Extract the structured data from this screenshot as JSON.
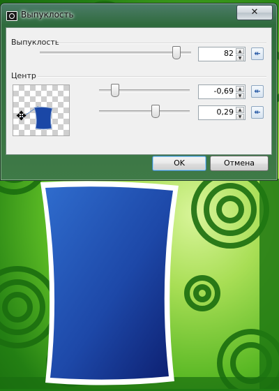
{
  "window": {
    "title": "Выпуклость",
    "close_glyph": "✕"
  },
  "convexity": {
    "label": "Выпуклость",
    "value": "82",
    "slider_fraction": 0.82
  },
  "center": {
    "label": "Центр",
    "x_value": "-0,69",
    "y_value": "0,29"
  },
  "buttons": {
    "ok_label": "OK",
    "cancel_label": "Отмена"
  },
  "icons": {
    "reset": "↞",
    "spin_up": "▲",
    "spin_down": "▼",
    "move": "✥"
  }
}
